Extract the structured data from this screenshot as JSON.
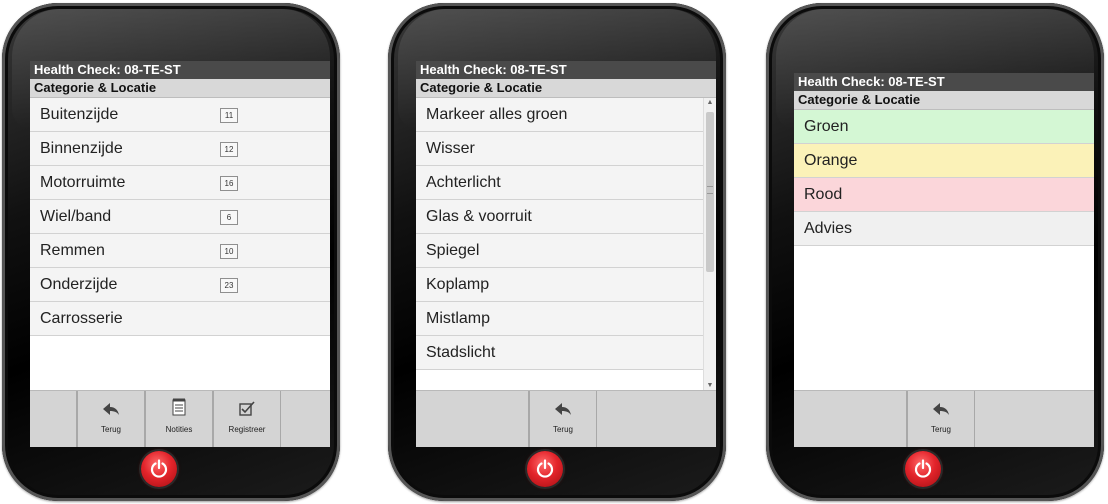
{
  "phones": [
    {
      "title": "Health Check: 08-TE-ST",
      "subtitle": "Categorie & Locatie",
      "items": [
        {
          "label": "Buitenzijde",
          "count": "11"
        },
        {
          "label": "Binnenzijde",
          "count": "12"
        },
        {
          "label": "Motorruimte",
          "count": "16"
        },
        {
          "label": "Wiel/band",
          "count": "6"
        },
        {
          "label": "Remmen",
          "count": "10"
        },
        {
          "label": "Onderzijde",
          "count": "23"
        },
        {
          "label": "Carrosserie",
          "count": ""
        }
      ],
      "toolbar": [
        {
          "label": "Terug",
          "icon": "back-arrow-icon"
        },
        {
          "label": "Notities",
          "icon": "notepad-icon"
        },
        {
          "label": "Registreer",
          "icon": "checkbox-icon"
        }
      ]
    },
    {
      "title": "Health Check: 08-TE-ST",
      "subtitle": "Categorie & Locatie",
      "items": [
        {
          "label": "Markeer alles groen"
        },
        {
          "label": "Wisser"
        },
        {
          "label": "Achterlicht"
        },
        {
          "label": "Glas & voorruit"
        },
        {
          "label": "Spiegel"
        },
        {
          "label": "Koplamp"
        },
        {
          "label": "Mistlamp"
        },
        {
          "label": "Stadslicht"
        }
      ],
      "toolbar": [
        {
          "label": "Terug",
          "icon": "back-arrow-icon"
        }
      ]
    },
    {
      "title": "Health Check: 08-TE-ST",
      "subtitle": "Categorie & Locatie",
      "items": [
        {
          "label": "Groen",
          "color": "#d4f7d4"
        },
        {
          "label": "Orange",
          "color": "#fbf2b8"
        },
        {
          "label": "Rood",
          "color": "#fbd6da"
        },
        {
          "label": "Advies",
          "color": "#f0f0f0"
        }
      ],
      "toolbar": [
        {
          "label": "Terug",
          "icon": "back-arrow-icon"
        }
      ]
    }
  ],
  "colors": {
    "power_button": "#e3242b",
    "titlebar": "#4a4a4a",
    "subbar": "#d8d8d8",
    "toolbar": "#d4d4d4"
  }
}
